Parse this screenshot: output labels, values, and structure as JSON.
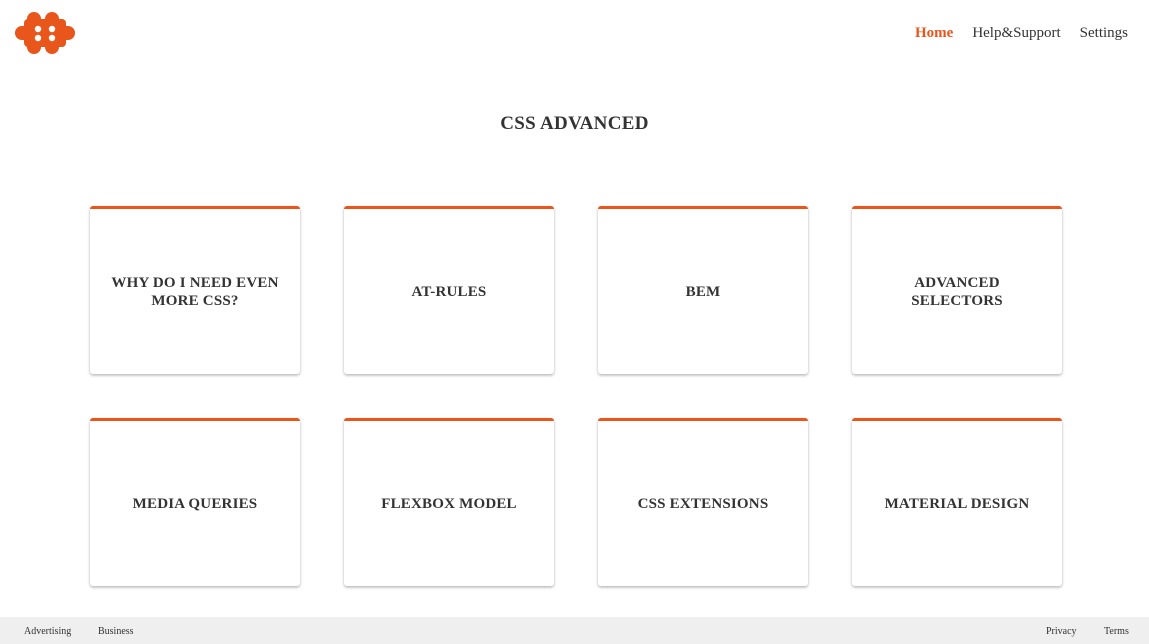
{
  "brand": {
    "accent_color": "#e8561c",
    "logo_icon": "orange-clover-logo"
  },
  "nav": {
    "items": [
      {
        "label": "Home",
        "active": true
      },
      {
        "label": "Help&Support",
        "active": false
      },
      {
        "label": "Settings",
        "active": false
      }
    ]
  },
  "main": {
    "title": "CSS ADVANCED",
    "cards": [
      {
        "label": "WHY DO I NEED EVEN MORE CSS?"
      },
      {
        "label": "AT-RULES"
      },
      {
        "label": "BEM"
      },
      {
        "label": "ADVANCED SELECTORS"
      },
      {
        "label": "MEDIA QUERIES"
      },
      {
        "label": "FLEXBOX MODEL"
      },
      {
        "label": "CSS EXTENSIONS"
      },
      {
        "label": "MATERIAL DESIGN"
      }
    ]
  },
  "footer": {
    "left": [
      {
        "label": "Advertising"
      },
      {
        "label": "Business"
      }
    ],
    "right": [
      {
        "label": "Privacy"
      },
      {
        "label": "Terms"
      }
    ]
  }
}
